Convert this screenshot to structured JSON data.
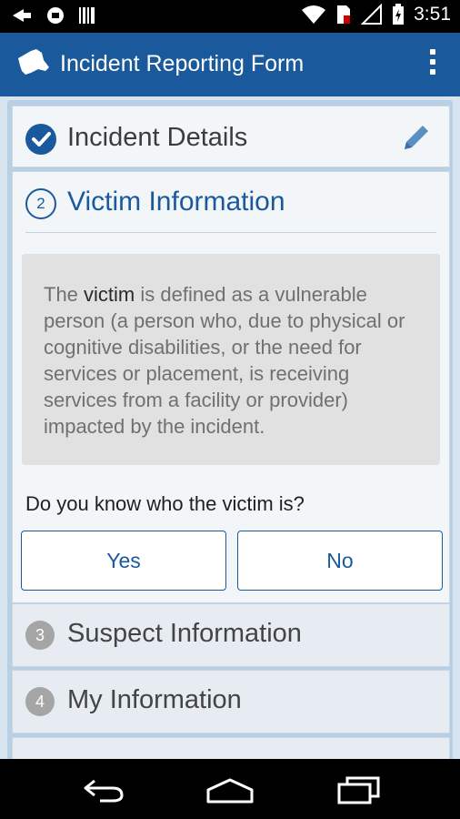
{
  "status_bar": {
    "time": "3:51",
    "icons": [
      "usb-icon",
      "android-debug-icon",
      "barcode-icon",
      "wifi-icon",
      "sim-icon",
      "signal-icon",
      "battery-charging-icon"
    ]
  },
  "action_bar": {
    "title": "Incident Reporting Form",
    "logo_icon": "new-york-state-icon",
    "menu_icon": "overflow-menu-icon"
  },
  "sections": [
    {
      "step": "1",
      "title": "Incident Details",
      "state": "completed",
      "icon": "checkmark-icon",
      "action_icon": "pencil-icon"
    },
    {
      "step": "2",
      "title": "Victim Information",
      "state": "active"
    },
    {
      "step": "3",
      "title": "Suspect Information",
      "state": "pending"
    },
    {
      "step": "4",
      "title": "My Information",
      "state": "pending"
    }
  ],
  "victim": {
    "info_prefix": "The ",
    "info_bold": "victim",
    "info_suffix": " is defined as a vulnerable person (a person who, due to physical or cognitive disabilities, or the need for services or placement, is receiving services from a facility or provider) impacted by the incident.",
    "question": "Do you know who the victim is?",
    "yes_label": "Yes",
    "no_label": "No"
  },
  "nav_bar": {
    "icons": [
      "back-icon",
      "home-icon",
      "recent-apps-icon"
    ]
  },
  "colors": {
    "brand": "#1a5a9c",
    "background": "#d7e3ef",
    "info_box": "#e1e1e1",
    "pending_step": "#a5a5a5"
  }
}
